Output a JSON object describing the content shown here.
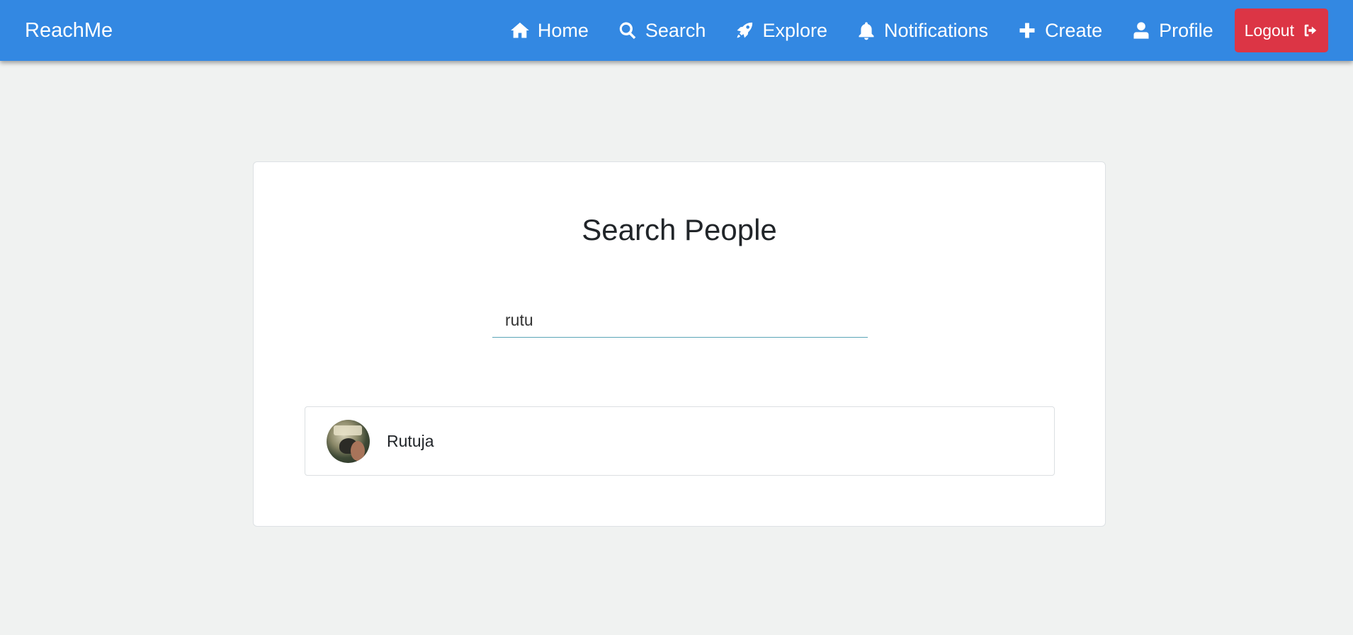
{
  "navbar": {
    "brand": "ReachMe",
    "color": "#3388e2",
    "items": [
      {
        "label": "Home",
        "icon": "home-icon"
      },
      {
        "label": "Search",
        "icon": "search-icon"
      },
      {
        "label": "Explore",
        "icon": "rocket-icon"
      },
      {
        "label": "Notifications",
        "icon": "bell-icon"
      },
      {
        "label": "Create",
        "icon": "plus-icon"
      },
      {
        "label": "Profile",
        "icon": "user-icon"
      }
    ],
    "logout": {
      "label": "Logout",
      "icon": "sign-out-icon",
      "color": "#dc3545"
    }
  },
  "search_page": {
    "title": "Search People",
    "search_value": "rutu",
    "results": [
      {
        "name": "Rutuja",
        "avatar": "avatar-photo"
      }
    ]
  }
}
